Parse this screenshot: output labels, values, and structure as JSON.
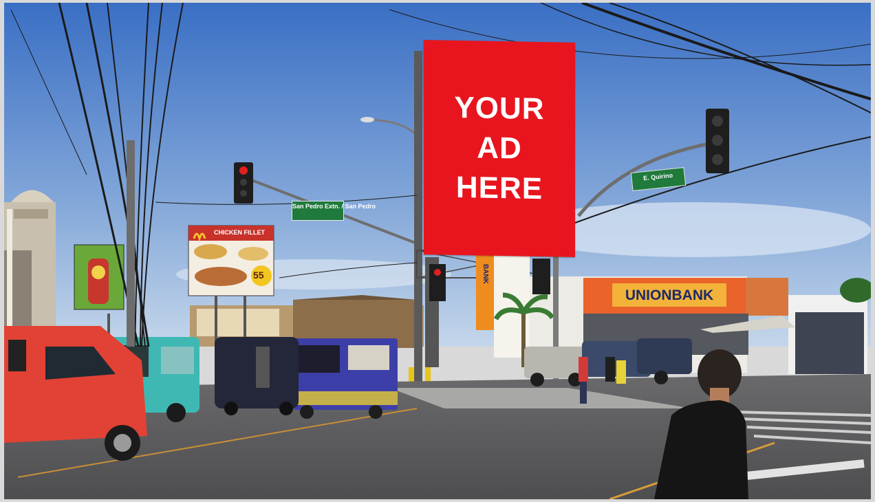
{
  "ad_panel": {
    "lines": [
      "YOUR",
      "AD",
      "HERE"
    ],
    "background": "#e8151f",
    "text_color": "#ffffff"
  },
  "bank_sign": {
    "name": "UNIONBANK"
  },
  "street_signs": [
    {
      "text": "San Pedro Extn. / San Pedro"
    },
    {
      "text": "E. Quirino"
    }
  ],
  "billboards": {
    "mcdo_headline": "CHICKEN FILLET",
    "mcdo_price": "55"
  },
  "colors": {
    "sky_top": "#3f74c7",
    "sky_bottom": "#bcd0e8",
    "road": "#57575a",
    "jeep_red": "#e14235",
    "jeep_teal": "#3fb8b4"
  }
}
